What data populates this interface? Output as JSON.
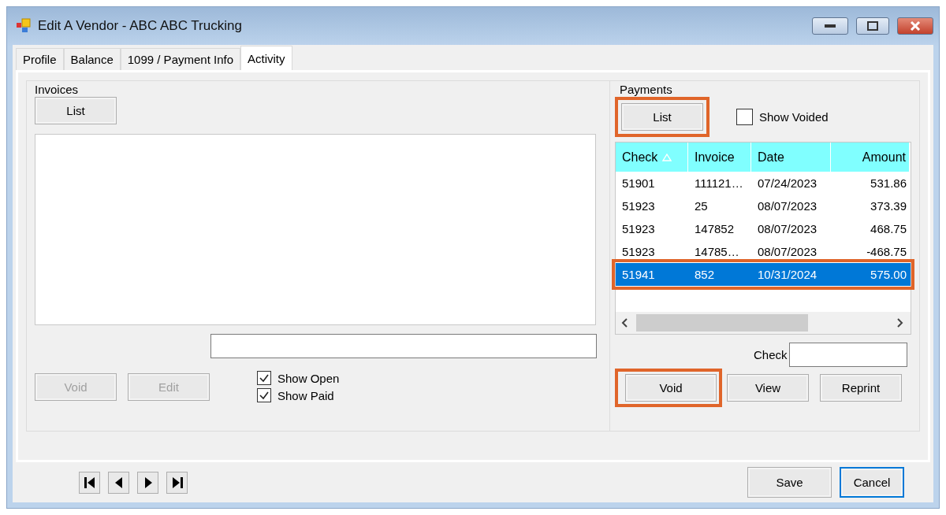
{
  "window": {
    "title": "Edit A Vendor - ABC ABC Trucking"
  },
  "tabs": [
    {
      "label": "Profile",
      "selected": false
    },
    {
      "label": "Balance",
      "selected": false
    },
    {
      "label": "1099 / Payment Info",
      "selected": false
    },
    {
      "label": "Activity",
      "selected": true
    }
  ],
  "invoices": {
    "legend": "Invoices",
    "list_button": {
      "label": "List"
    },
    "buttons": [
      {
        "label": "Void",
        "disabled": true
      },
      {
        "label": "Edit",
        "disabled": true
      }
    ],
    "options": [
      {
        "label": "Show Open",
        "checked": true
      },
      {
        "label": "Show Paid",
        "checked": true
      }
    ]
  },
  "payments": {
    "legend": "Payments",
    "list_button": {
      "label": "List",
      "highlighted": true
    },
    "show_voided": {
      "label": "Show Voided",
      "checked": false
    },
    "table": {
      "columns": [
        {
          "label": "Check",
          "sorted": true
        },
        {
          "label": "Invoice",
          "sorted": false
        },
        {
          "label": "Date",
          "sorted": false
        },
        {
          "label": "Amount",
          "sorted": false
        }
      ],
      "rows": [
        {
          "cells": [
            "51901",
            "111121…",
            "07/24/2023",
            "531.86"
          ],
          "selected": false,
          "highlighted": false
        },
        {
          "cells": [
            "51923",
            "25",
            "08/07/2023",
            "373.39"
          ],
          "selected": false,
          "highlighted": false
        },
        {
          "cells": [
            "51923",
            "147852",
            "08/07/2023",
            "468.75"
          ],
          "selected": false,
          "highlighted": false
        },
        {
          "cells": [
            "51923",
            "14785…",
            "08/07/2023",
            "-468.75"
          ],
          "selected": false,
          "highlighted": false
        },
        {
          "cells": [
            "51941",
            "852",
            "10/31/2024",
            "575.00"
          ],
          "selected": true,
          "highlighted": true
        }
      ]
    },
    "check_label": "Check",
    "buttons": [
      {
        "label": "Void",
        "highlighted": true
      },
      {
        "label": "View",
        "highlighted": false
      },
      {
        "label": "Reprint",
        "highlighted": false
      }
    ]
  },
  "footer": {
    "buttons": [
      {
        "label": "Save",
        "default": false
      },
      {
        "label": "Cancel",
        "default": true
      }
    ]
  }
}
